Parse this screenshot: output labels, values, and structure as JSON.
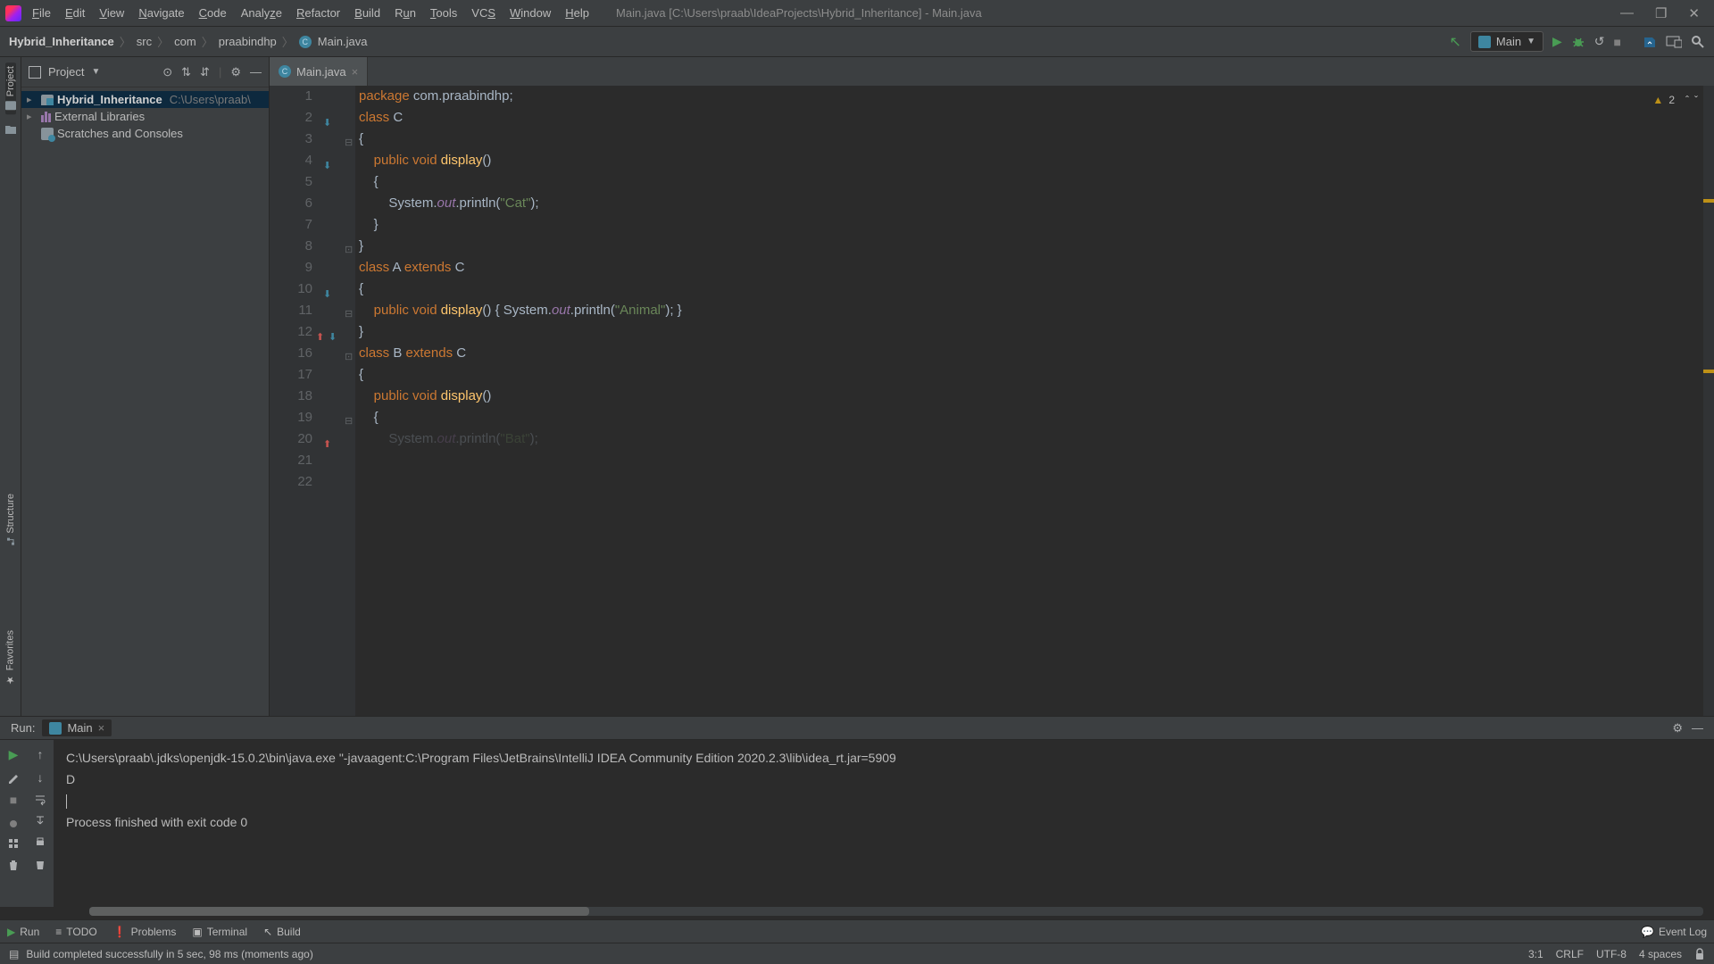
{
  "titlebar": {
    "window_title": "Main.java [C:\\Users\\praab\\IdeaProjects\\Hybrid_Inheritance] - Main.java",
    "menu": [
      "File",
      "Edit",
      "View",
      "Navigate",
      "Code",
      "Analyze",
      "Refactor",
      "Build",
      "Run",
      "Tools",
      "VCS",
      "Window",
      "Help"
    ]
  },
  "breadcrumb": {
    "root": "Hybrid_Inheritance",
    "items": [
      "src",
      "com",
      "praabindhp",
      "Main.java"
    ]
  },
  "run_config": {
    "name": "Main"
  },
  "project_panel": {
    "title": "Project",
    "tree": {
      "root_name": "Hybrid_Inheritance",
      "root_path": "C:\\Users\\praab\\",
      "ext_libs": "External Libraries",
      "scratches": "Scratches and Consoles"
    }
  },
  "tab": {
    "name": "Main.java"
  },
  "inspections": {
    "warn_count": "2"
  },
  "code": {
    "lines": [
      {
        "num": "1",
        "tokens": [
          [
            "kw",
            "package "
          ],
          [
            "pln",
            "com.praabindhp;"
          ]
        ],
        "gutter": ""
      },
      {
        "num": "2",
        "tokens": [
          [
            "kw",
            "class "
          ],
          [
            "cls",
            "C"
          ]
        ],
        "gutter": "override"
      },
      {
        "num": "3",
        "tokens": [
          [
            "pln",
            "{"
          ]
        ],
        "fold": "open"
      },
      {
        "num": "4",
        "tokens": [
          [
            "pln",
            "    "
          ],
          [
            "kw",
            "public void "
          ],
          [
            "fn",
            "display"
          ],
          [
            "pln",
            "()"
          ]
        ],
        "gutter": "override"
      },
      {
        "num": "5",
        "tokens": [
          [
            "pln",
            "    {"
          ]
        ]
      },
      {
        "num": "6",
        "tokens": [
          [
            "pln",
            "        System."
          ],
          [
            "fld",
            "out"
          ],
          [
            "pln",
            ".println("
          ],
          [
            "str",
            "\"Cat\""
          ],
          [
            "pln",
            ");"
          ]
        ]
      },
      {
        "num": "7",
        "tokens": [
          [
            "pln",
            "    }"
          ]
        ]
      },
      {
        "num": "8",
        "tokens": [
          [
            "pln",
            "}"
          ]
        ],
        "fold": "close"
      },
      {
        "num": "9",
        "tokens": [
          [
            "pln",
            ""
          ]
        ]
      },
      {
        "num": "10",
        "tokens": [
          [
            "kw",
            "class "
          ],
          [
            "cls",
            "A "
          ],
          [
            "kw",
            "extends "
          ],
          [
            "cls",
            "C"
          ]
        ],
        "gutter": "override"
      },
      {
        "num": "11",
        "tokens": [
          [
            "pln",
            "{"
          ]
        ],
        "fold": "open"
      },
      {
        "num": "12",
        "tokens": [
          [
            "pln",
            "    "
          ],
          [
            "kw",
            "public void "
          ],
          [
            "fn",
            "display"
          ],
          [
            "pln",
            "() { System."
          ],
          [
            "fld",
            "out"
          ],
          [
            "pln",
            ".println("
          ],
          [
            "str",
            "\"Animal\""
          ],
          [
            "pln",
            "); }"
          ]
        ],
        "gutter": "both"
      },
      {
        "num": "16",
        "tokens": [
          [
            "pln",
            "}"
          ]
        ],
        "fold": "close"
      },
      {
        "num": "17",
        "tokens": [
          [
            "pln",
            ""
          ]
        ],
        "cursor": true
      },
      {
        "num": "18",
        "tokens": [
          [
            "kw",
            "class "
          ],
          [
            "cls",
            "B "
          ],
          [
            "kw",
            "extends "
          ],
          [
            "cls",
            "C"
          ]
        ]
      },
      {
        "num": "19",
        "tokens": [
          [
            "pln",
            "{"
          ]
        ],
        "fold": "open"
      },
      {
        "num": "20",
        "tokens": [
          [
            "pln",
            "    "
          ],
          [
            "kw",
            "public void "
          ],
          [
            "fn",
            "display"
          ],
          [
            "pln",
            "()"
          ]
        ],
        "gutter": "impl"
      },
      {
        "num": "21",
        "tokens": [
          [
            "pln",
            "    {"
          ]
        ]
      },
      {
        "num": "22",
        "tokens": [
          [
            "pln",
            "        System."
          ],
          [
            "fld",
            "out"
          ],
          [
            "pln",
            ".println("
          ],
          [
            "str",
            "\"Bat\""
          ],
          [
            "pln",
            ");"
          ]
        ],
        "trunc": true
      }
    ]
  },
  "run": {
    "title": "Run:",
    "tab_name": "Main",
    "console": {
      "cmd": "C:\\Users\\praab\\.jdks\\openjdk-15.0.2\\bin\\java.exe \"-javaagent:C:\\Program Files\\JetBrains\\IntelliJ IDEA Community Edition 2020.2.3\\lib\\idea_rt.jar=5909",
      "out1": "D",
      "exit": "Process finished with exit code 0"
    }
  },
  "bottom_tabs": {
    "run": "Run",
    "todo": "TODO",
    "problems": "Problems",
    "terminal": "Terminal",
    "build": "Build",
    "event_log": "Event Log"
  },
  "status": {
    "message": "Build completed successfully in 5 sec, 98 ms (moments ago)",
    "pos": "3:1",
    "sep": "CRLF",
    "enc": "UTF-8",
    "indent": "4 spaces"
  },
  "left_strip": {
    "project": "Project",
    "structure": "Structure",
    "favorites": "Favorites"
  }
}
